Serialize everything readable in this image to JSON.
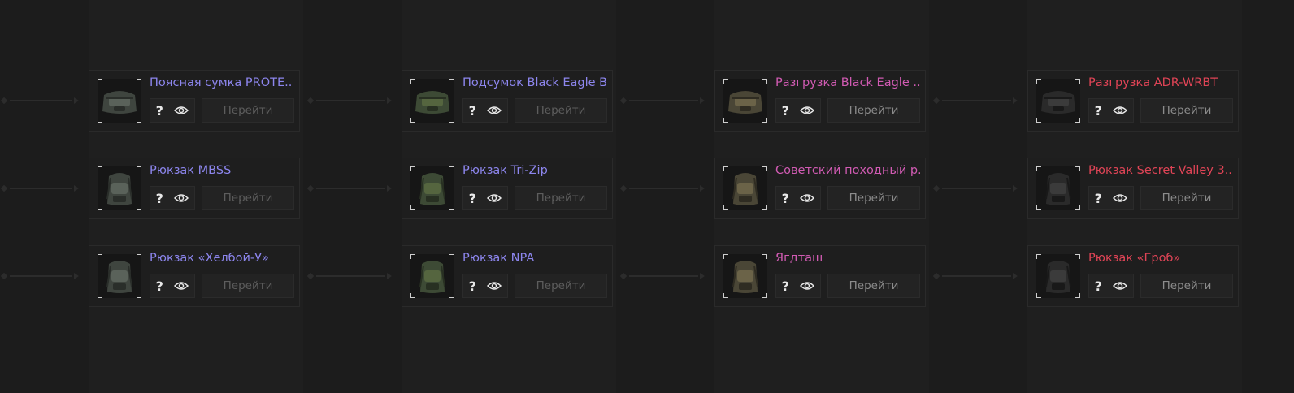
{
  "go_label": "Перейти",
  "help_label": "?",
  "colors": {
    "tier_1": "#8d86ee",
    "tier_2": "#d15bb3",
    "tier_3": "#e04456"
  },
  "rows": [
    [
      {
        "title": "Поясная сумка PROTE..",
        "tier": 1,
        "icon": "waist-bag-icon"
      },
      {
        "title": "Подсумок Black Eagle B..",
        "tier": 1,
        "icon": "pouch-icon"
      },
      {
        "title": "Разгрузка Black Eagle ..",
        "tier": 2,
        "icon": "chest-rig-icon"
      },
      {
        "title": "Разгрузка ADR-WRBT",
        "tier": 3,
        "icon": "chest-rig-icon"
      }
    ],
    [
      {
        "title": "Рюкзак MBSS",
        "tier": 1,
        "icon": "backpack-icon"
      },
      {
        "title": "Рюкзак Tri-Zip",
        "tier": 1,
        "icon": "backpack-icon"
      },
      {
        "title": "Советский походный р..",
        "tier": 2,
        "icon": "backpack-icon"
      },
      {
        "title": "Рюкзак Secret Valley 3..",
        "tier": 3,
        "icon": "backpack-icon"
      }
    ],
    [
      {
        "title": "Рюкзак «Хелбой-У»",
        "tier": 1,
        "icon": "backpack-icon"
      },
      {
        "title": "Рюкзак NPA",
        "tier": 1,
        "icon": "backpack-icon"
      },
      {
        "title": "Ягдташ",
        "tier": 2,
        "icon": "hunting-bag-icon"
      },
      {
        "title": "Рюкзак «Гроб»",
        "tier": 3,
        "icon": "backpack-icon"
      }
    ]
  ]
}
